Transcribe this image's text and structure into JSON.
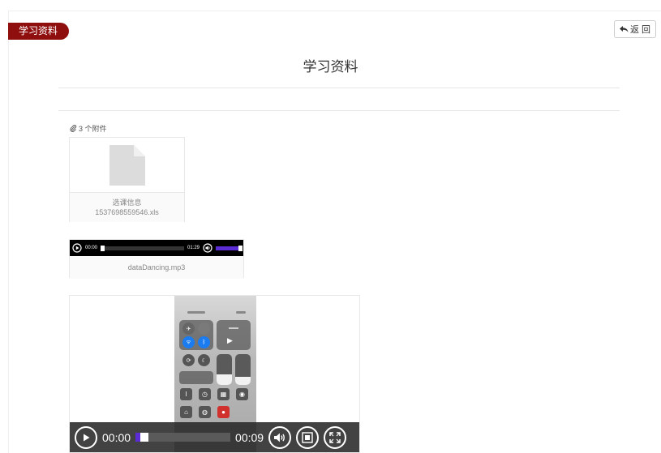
{
  "header": {
    "tag_label": "学习资料",
    "back_label": "返 回"
  },
  "page_title": "学习资料",
  "attachments": {
    "count_label": "3 个附件",
    "file": {
      "name_line1": "选课信息",
      "name_line2": "1537698559546.xls"
    },
    "audio": {
      "current_time": "00:00",
      "duration": "01:29",
      "progress": 0.0,
      "volume": 1.0,
      "filename": "dataDancing.mp3"
    },
    "video": {
      "current_time": "00:00",
      "duration": "00:09",
      "progress": 0.05
    }
  },
  "colors": {
    "brand": "#8f0f0f",
    "accent": "#5b2bd6"
  },
  "icons": {
    "back": "reply-arrow-icon",
    "attachment": "paperclip-icon",
    "file": "document-icon"
  }
}
